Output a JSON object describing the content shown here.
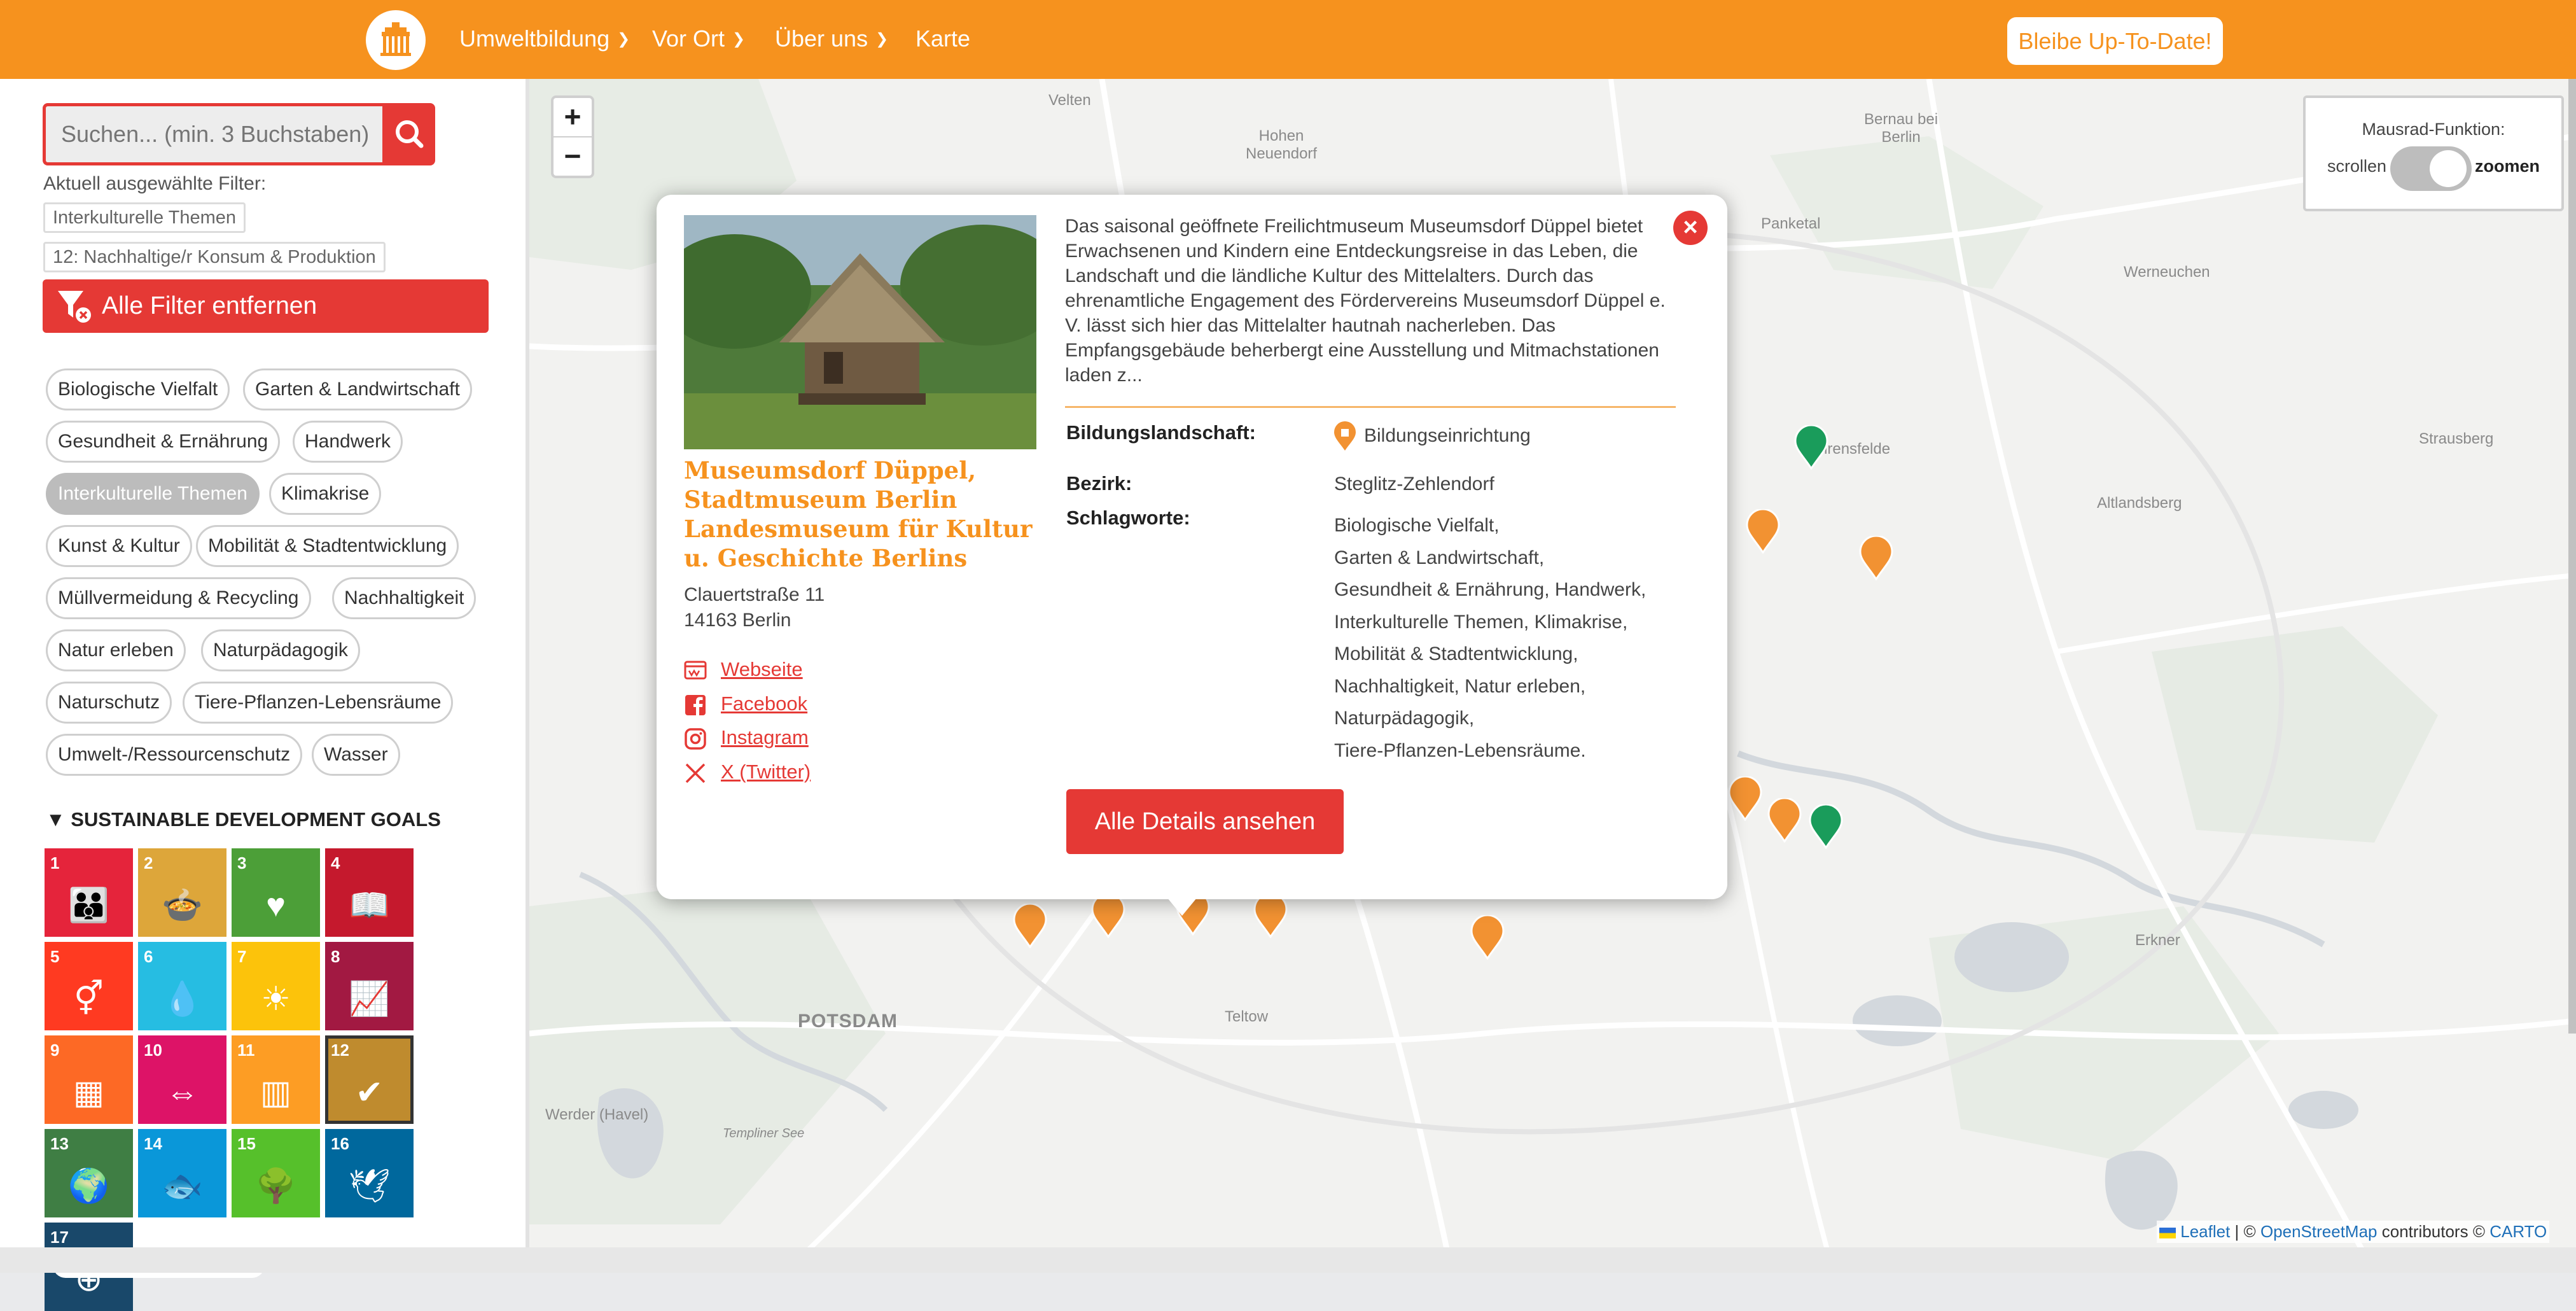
{
  "header": {
    "nav": [
      {
        "label": "Umweltbildung",
        "has_dropdown": true
      },
      {
        "label": "Vor Ort",
        "has_dropdown": true
      },
      {
        "label": "Über uns",
        "has_dropdown": true
      },
      {
        "label": "Karte",
        "has_dropdown": false
      }
    ],
    "cta_label": "Bleibe Up-To-Date!",
    "logo_icon": "brandenburg-gate-icon",
    "accent_color": "#f6921e"
  },
  "sidebar": {
    "search_placeholder": "Suchen... (min. 3 Buchstaben)",
    "current_filters_label": "Aktuell ausgewählte Filter:",
    "selected_filters": [
      "Interkulturelle Themen",
      "12: Nachhaltige/r Konsum & Produktion"
    ],
    "clear_all_label": "Alle Filter entfernen",
    "topics": [
      {
        "label": "Biologische Vielfalt",
        "active": false
      },
      {
        "label": "Garten & Landwirtschaft",
        "active": false
      },
      {
        "label": "Gesundheit & Ernährung",
        "active": false
      },
      {
        "label": "Handwerk",
        "active": false
      },
      {
        "label": "Interkulturelle Themen",
        "active": true
      },
      {
        "label": "Klimakrise",
        "active": false
      },
      {
        "label": "Kunst & Kultur",
        "active": false
      },
      {
        "label": "Mobilität & Stadtentwicklung",
        "active": false
      },
      {
        "label": "Müllvermeidung & Recycling",
        "active": false
      },
      {
        "label": "Nachhaltigkeit",
        "active": false
      },
      {
        "label": "Natur erleben",
        "active": false
      },
      {
        "label": "Naturpädagogik",
        "active": false
      },
      {
        "label": "Naturschutz",
        "active": false
      },
      {
        "label": "Tiere-Pflanzen-Lebensräume",
        "active": false
      },
      {
        "label": "Umwelt-/Ressourcenschutz",
        "active": false
      },
      {
        "label": "Wasser",
        "active": false
      }
    ],
    "sdg_heading": "SUSTAINABLE DEVELOPMENT GOALS",
    "sdgs": [
      {
        "num": "1",
        "color": "#e5243b"
      },
      {
        "num": "2",
        "color": "#dda63a"
      },
      {
        "num": "3",
        "color": "#4c9f38"
      },
      {
        "num": "4",
        "color": "#c5192d"
      },
      {
        "num": "5",
        "color": "#ff3a21"
      },
      {
        "num": "6",
        "color": "#26bde2"
      },
      {
        "num": "7",
        "color": "#fcc30b"
      },
      {
        "num": "8",
        "color": "#a21942"
      },
      {
        "num": "9",
        "color": "#fd6925"
      },
      {
        "num": "10",
        "color": "#dd1367"
      },
      {
        "num": "11",
        "color": "#fd9d24"
      },
      {
        "num": "12",
        "color": "#bf8b2e"
      },
      {
        "num": "13",
        "color": "#3f7e44"
      },
      {
        "num": "14",
        "color": "#0a97d9"
      },
      {
        "num": "15",
        "color": "#56c02b"
      },
      {
        "num": "16",
        "color": "#00689d"
      },
      {
        "num": "17",
        "color": "#19486a"
      }
    ]
  },
  "map": {
    "places": [
      {
        "name": "Velten",
        "big": false
      },
      {
        "name": "Hohen Neuendorf",
        "big": false
      },
      {
        "name": "Bernau bei Berlin",
        "big": false
      },
      {
        "name": "Panketal",
        "big": false
      },
      {
        "name": "Werneuchen",
        "big": false
      },
      {
        "name": "Strausberg",
        "big": false
      },
      {
        "name": "Ahrensfelde",
        "big": false
      },
      {
        "name": "Altlandsberg",
        "big": false
      },
      {
        "name": "Erkner",
        "big": false
      },
      {
        "name": "POTSDAM",
        "big": true
      },
      {
        "name": "Teltow",
        "big": false
      },
      {
        "name": "Werder (Havel)",
        "big": false
      },
      {
        "name": "Templiner See",
        "big": false
      }
    ],
    "zoom_in": "+",
    "zoom_out": "−",
    "mouse_wheel": {
      "title": "Mausrad-Funktion:",
      "left": "scrollen",
      "right": "zoomen"
    },
    "attribution": {
      "leaflet": "Leaflet",
      "sep": "|",
      "copy": "©",
      "osm": "OpenStreetMap",
      "contributors": "contributors ©",
      "carto": "CARTO"
    }
  },
  "popup": {
    "title": "Museumsdorf Düppel, Stadtmuseum Berlin Landesmuseum für Kultur u. Geschichte Berlins",
    "address_line1": "Clauertstraße 11",
    "address_line2": "14163 Berlin",
    "links": [
      {
        "label": "Webseite",
        "icon": "website-icon"
      },
      {
        "label": "Facebook",
        "icon": "facebook-icon"
      },
      {
        "label": "Instagram",
        "icon": "instagram-icon"
      },
      {
        "label": "X (Twitter)",
        "icon": "x-twitter-icon"
      }
    ],
    "description": "Das saisonal geöffnete Freilichtmuseum Museumsdorf Düppel bietet Erwachsenen und Kindern eine Entdeckungsreise in das Leben, die Landschaft und die ländliche Kultur des Mittelalters. Durch das ehrenamtliche Engagement des Fördervereins Museumsdorf Düppel e. V. lässt sich hier das Mittelalter hautnah nacherleben. Das Empfangsgebäude beherbergt eine Ausstellung und Mitmachstationen laden z...",
    "bildungslandschaft_label": "Bildungslandschaft:",
    "bildungslandschaft_value": "Bildungseinrichtung",
    "bezirk_label": "Bezirk:",
    "bezirk_value": "Steglitz-Zehlendorf",
    "schlagworte_label": "Schlagworte:",
    "schlagworte_lines": [
      "Biologische Vielfalt,",
      "Garten & Landwirtschaft,",
      "Gesundheit & Ernährung, Handwerk,",
      "Interkulturelle Themen, Klimakrise,",
      "Mobilität & Stadtentwicklung,",
      "Nachhaltigkeit, Natur erleben,",
      "Naturpädagogik,",
      "Tiere-Pflanzen-Lebensräume."
    ],
    "details_button": "Alle Details ansehen",
    "close_label": "×"
  }
}
